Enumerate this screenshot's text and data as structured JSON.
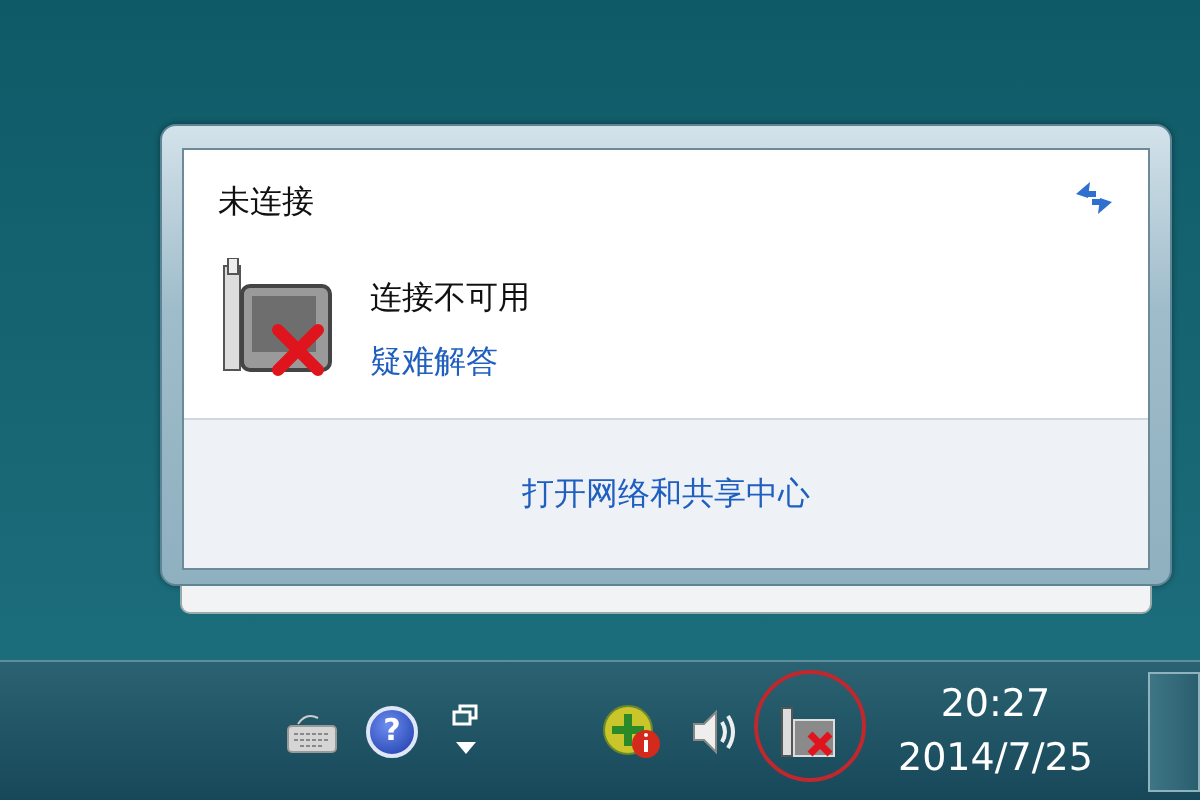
{
  "popup": {
    "title": "未连接",
    "status": "连接不可用",
    "troubleshoot_link": "疑难解答",
    "footer_link": "打开网络和共享中心"
  },
  "taskbar": {
    "help_glyph": "?",
    "network_highlighted": true,
    "clock": {
      "time": "20:27",
      "date": "2014/7/25"
    }
  }
}
